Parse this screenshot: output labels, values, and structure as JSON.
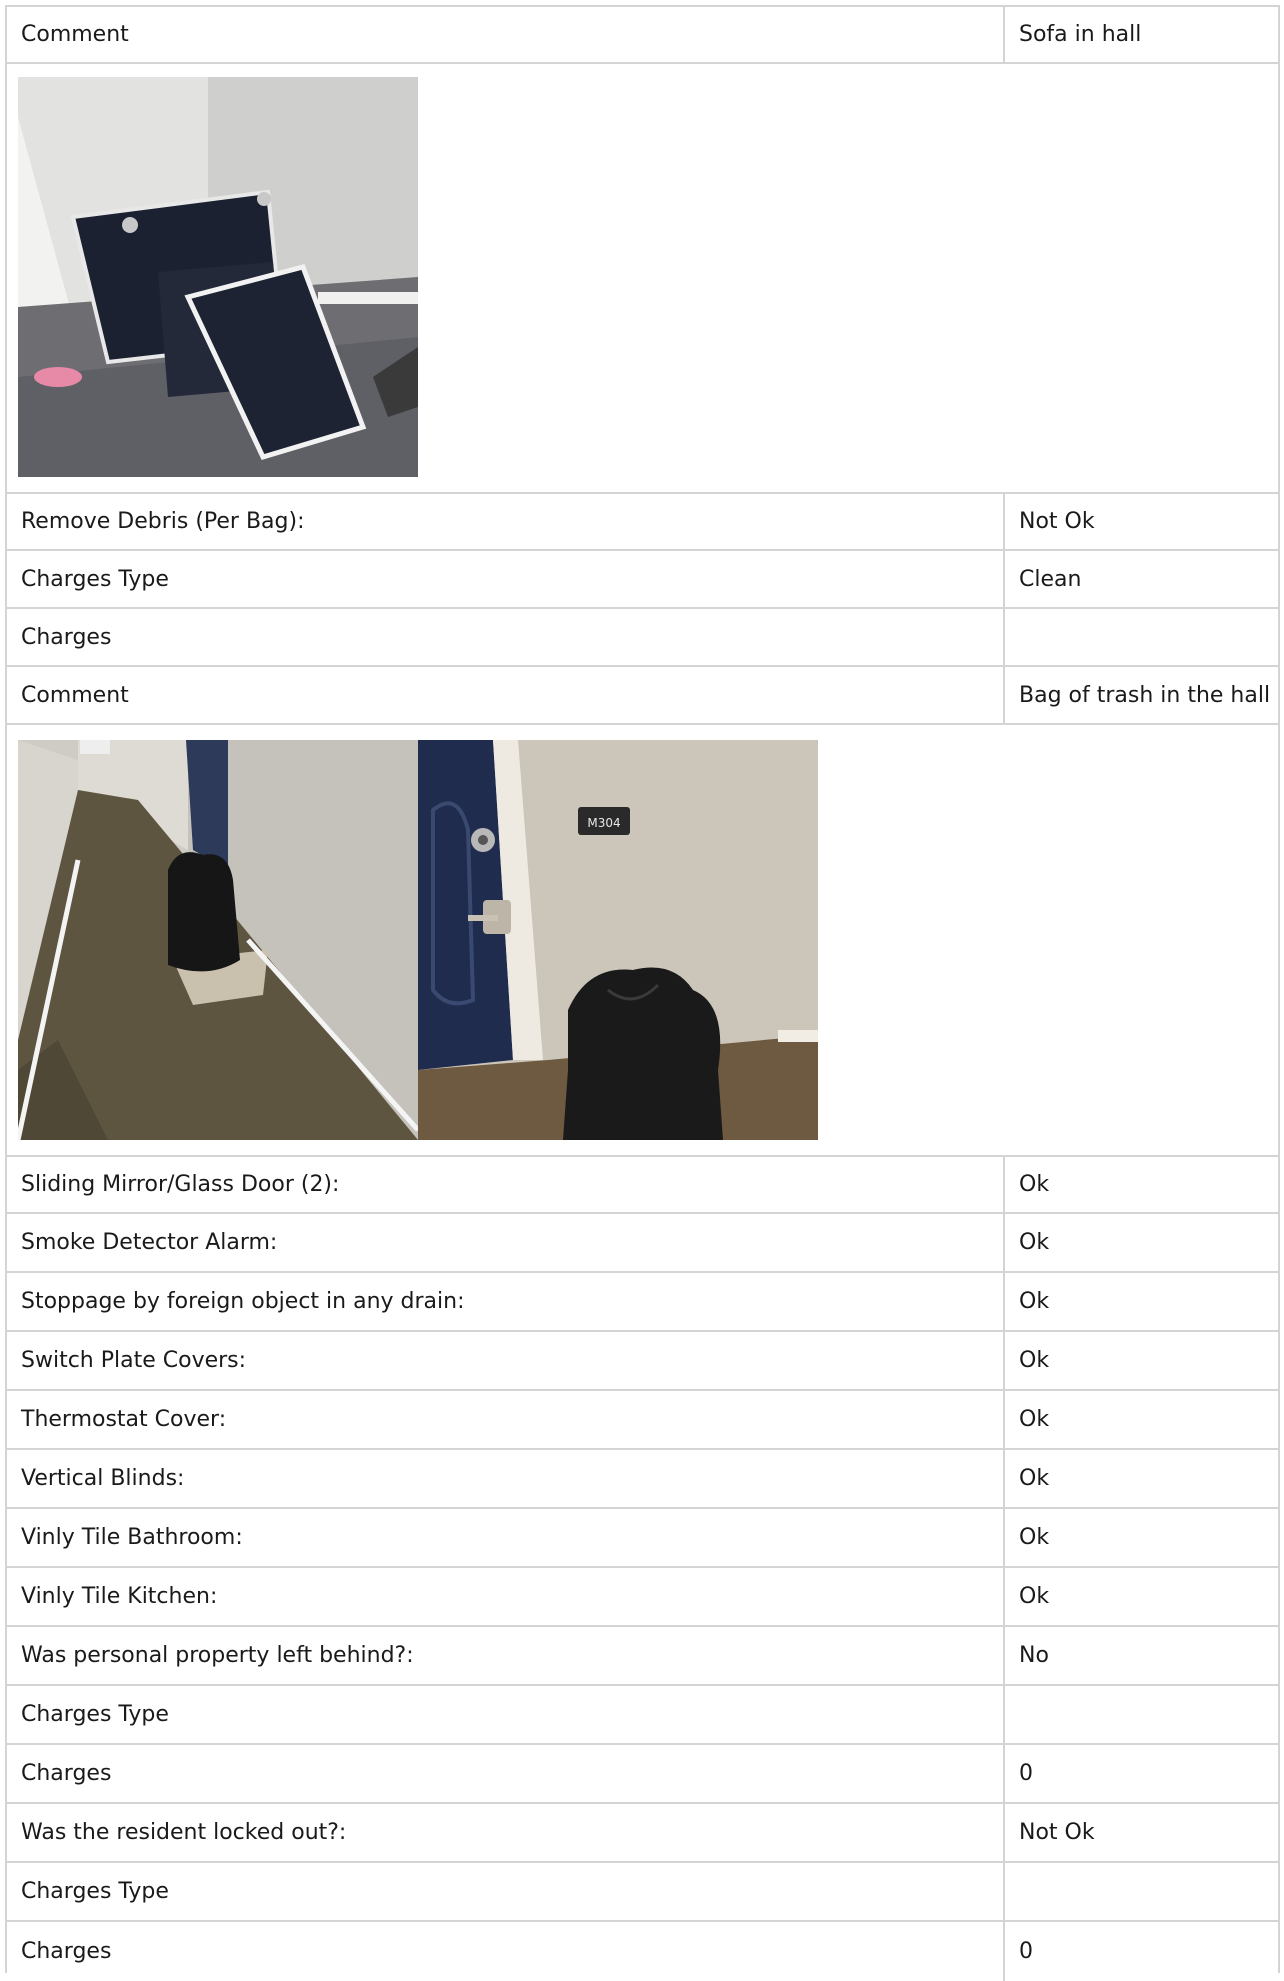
{
  "rows": [
    {
      "label": "Comment",
      "value": "Sofa in hall"
    },
    {
      "label": "Remove Debris (Per Bag):",
      "value": "Not Ok"
    },
    {
      "label": "Charges Type",
      "value": "Clean"
    },
    {
      "label": "Charges",
      "value": ""
    },
    {
      "label": "Comment",
      "value": "Bag of trash in the hall"
    },
    {
      "label": "Sliding Mirror/Glass Door (2):",
      "value": "Ok"
    },
    {
      "label": "Smoke Detector Alarm:",
      "value": "Ok"
    },
    {
      "label": "Stoppage by foreign object in any drain:",
      "value": "Ok"
    },
    {
      "label": "Switch Plate Covers:",
      "value": "Ok"
    },
    {
      "label": "Thermostat Cover:",
      "value": "Ok"
    },
    {
      "label": "Vertical Blinds:",
      "value": "Ok"
    },
    {
      "label": "Vinly Tile Bathroom:",
      "value": "Ok"
    },
    {
      "label": "Vinly Tile Kitchen:",
      "value": "Ok"
    },
    {
      "label": "Was personal property left behind?:",
      "value": "No"
    },
    {
      "label": "Charges Type",
      "value": ""
    },
    {
      "label": "Charges",
      "value": "0"
    },
    {
      "label": "Was the resident locked out?:",
      "value": "Not Ok"
    },
    {
      "label": "Charges Type",
      "value": ""
    },
    {
      "label": "Charges",
      "value": "0"
    }
  ],
  "photos": {
    "door_plate_text": "M304"
  }
}
